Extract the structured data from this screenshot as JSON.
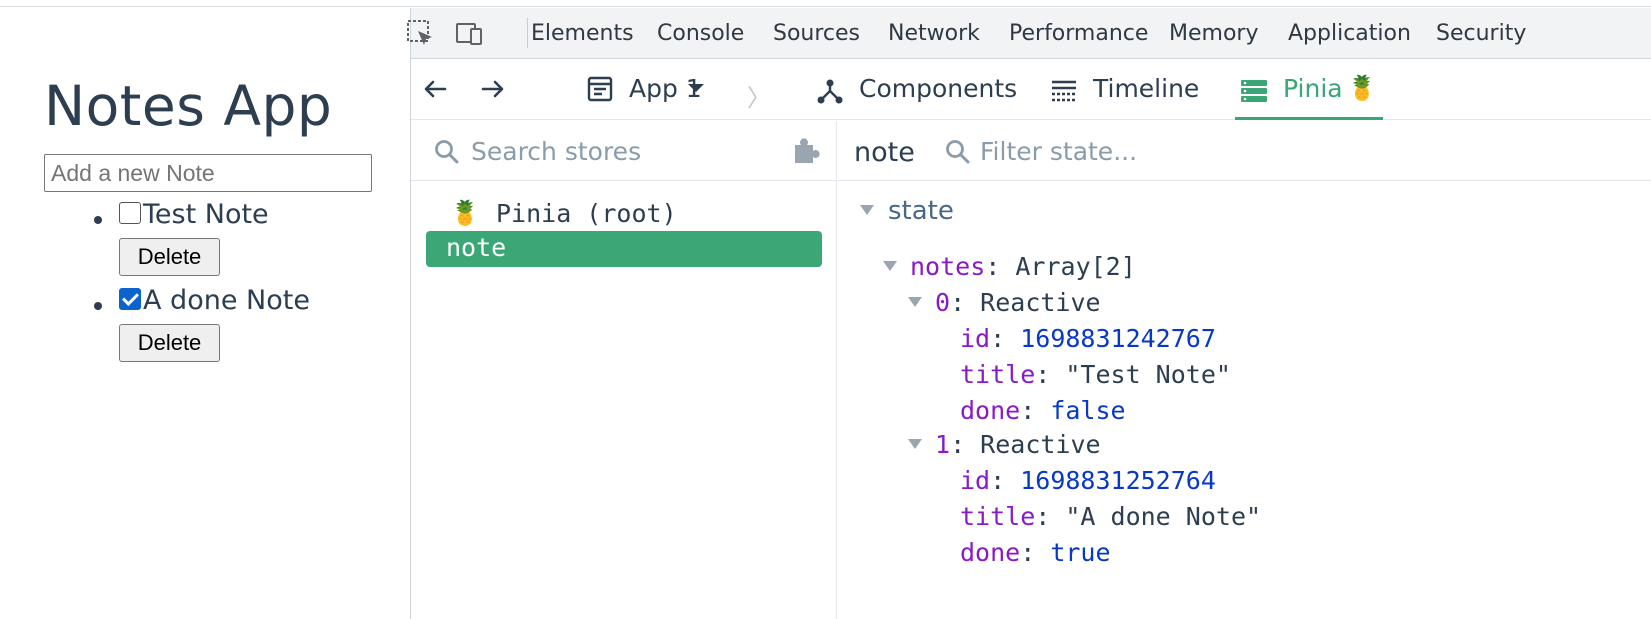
{
  "app": {
    "title": "Notes App",
    "input_placeholder": "Add a new Note",
    "notes": [
      {
        "title": "Test Note",
        "done": false,
        "delete_label": "Delete"
      },
      {
        "title": "A done Note",
        "done": true,
        "delete_label": "Delete"
      }
    ]
  },
  "devtools": {
    "tabs": [
      "Elements",
      "Console",
      "Sources",
      "Network",
      "Performance",
      "Memory",
      "Application",
      "Security"
    ],
    "vue": {
      "app_selector": "App 1",
      "tabs": [
        {
          "label": "Components",
          "active": false
        },
        {
          "label": "Timeline",
          "active": false
        },
        {
          "label": "Pinia",
          "active": true
        }
      ],
      "pinia_emoji": "🍍",
      "stores": {
        "search_placeholder": "Search stores",
        "items": [
          {
            "label": "Pinia (root)",
            "icon": "pineapple-icon",
            "selected": false
          },
          {
            "label": "note",
            "selected": true
          }
        ]
      },
      "state": {
        "store_name": "note",
        "filter_placeholder": "Filter state...",
        "section": "state",
        "notes_key": "notes",
        "notes_type": "Array[2]",
        "items": [
          {
            "index": "0",
            "type": "Reactive",
            "id": "1698831242767",
            "title": "\"Test Note\"",
            "done": "false"
          },
          {
            "index": "1",
            "type": "Reactive",
            "id": "1698831252764",
            "title": "\"A done Note\"",
            "done": "true"
          }
        ]
      }
    }
  },
  "colors": {
    "accent_green": "#3ba776",
    "key_purple": "#881ac7",
    "value_blue": "#0838c6",
    "text_dark": "#2c3e50"
  }
}
